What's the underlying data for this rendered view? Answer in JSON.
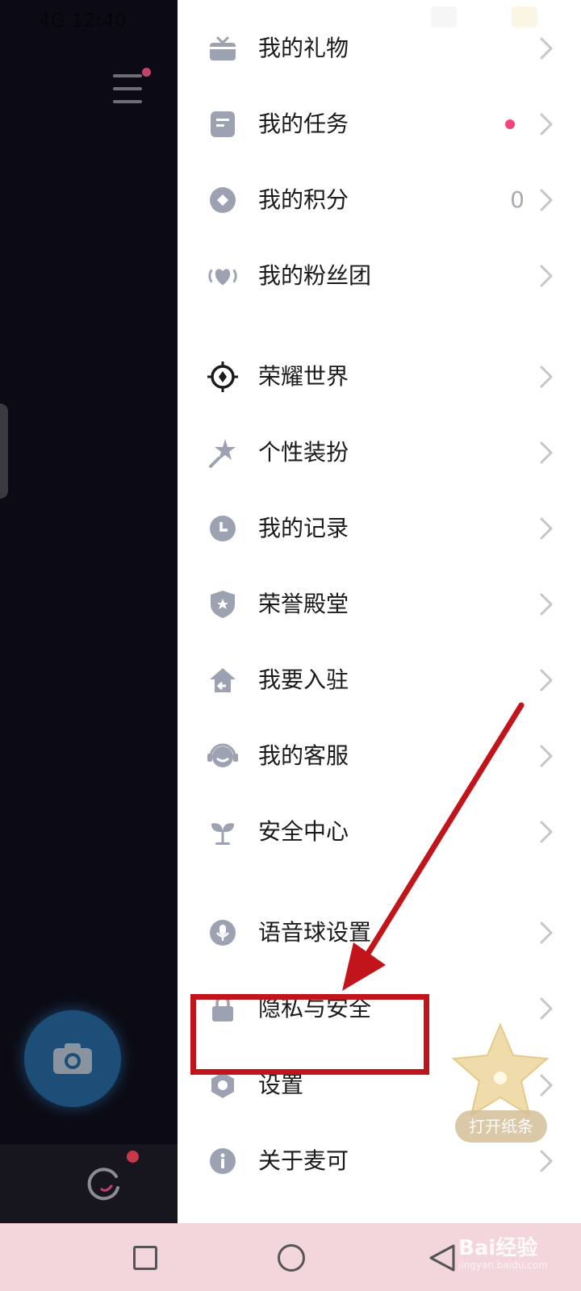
{
  "status_bar": {
    "left_text": "4G 12:40"
  },
  "drawer": {
    "items": [
      {
        "label": "我的礼物",
        "icon": "gift-icon"
      },
      {
        "label": "我的任务",
        "icon": "task-icon",
        "has_dot": true
      },
      {
        "label": "我的积分",
        "icon": "points-icon",
        "value": "0"
      },
      {
        "label": "我的粉丝团",
        "icon": "fan-club-icon"
      },
      {
        "label": "荣耀世界",
        "icon": "glory-world-icon"
      },
      {
        "label": "个性装扮",
        "icon": "dress-up-icon"
      },
      {
        "label": "我的记录",
        "icon": "clock-icon"
      },
      {
        "label": "荣誉殿堂",
        "icon": "shield-star-icon"
      },
      {
        "label": "我要入驻",
        "icon": "house-icon"
      },
      {
        "label": "我的客服",
        "icon": "headset-icon"
      },
      {
        "label": "安全中心",
        "icon": "sprout-icon"
      },
      {
        "label": "语音球设置",
        "icon": "microphone-icon"
      },
      {
        "label": "隐私与安全",
        "icon": "lock-icon"
      },
      {
        "label": "设置",
        "icon": "hexagon-settings-icon"
      },
      {
        "label": "关于麦可",
        "icon": "info-icon"
      }
    ]
  },
  "floating_badge": {
    "label": "打开纸条",
    "icon": "star-icon"
  },
  "watermark": {
    "text": "Bai经验",
    "subtext": "jingyan.baidu.com"
  },
  "colors": {
    "icon_gray": "#9da2b2",
    "highlight_red": "#c2141b",
    "notification_pink": "#f2457a",
    "navbar_bg": "#f3d5dc"
  }
}
